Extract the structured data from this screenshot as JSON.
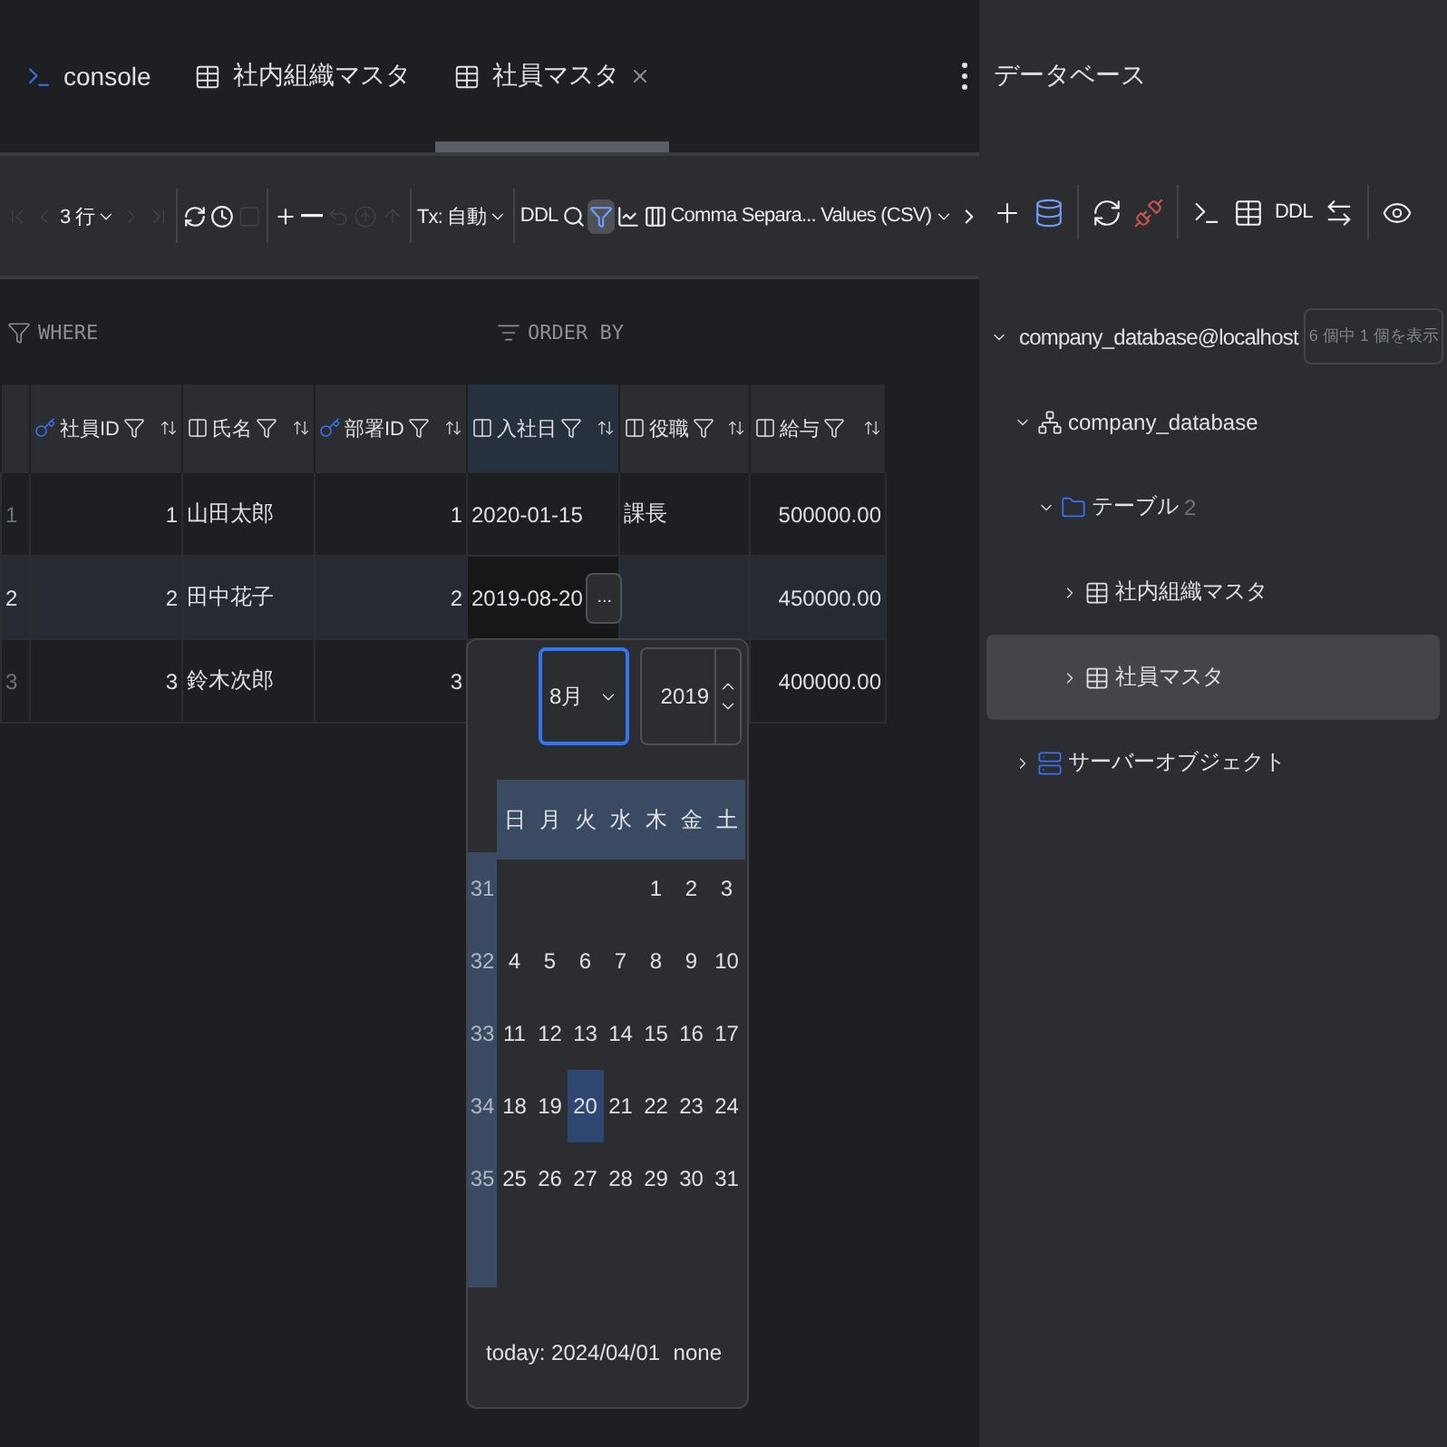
{
  "tabs": [
    {
      "label": "console",
      "kind": "console",
      "selected": false,
      "closable": false
    },
    {
      "label": "社内組織マスタ",
      "kind": "table",
      "selected": false,
      "closable": false
    },
    {
      "label": "社員マスタ",
      "kind": "table",
      "selected": true,
      "closable": true
    }
  ],
  "toolbar": [
    {
      "kind": "first",
      "disabled": true
    },
    {
      "kind": "prev",
      "disabled": true
    },
    {
      "kind": "dropdown",
      "label": "3 行",
      "disabled": false
    },
    {
      "kind": "next",
      "disabled": true
    },
    {
      "kind": "last",
      "disabled": true
    },
    {
      "kind": "sep"
    },
    {
      "kind": "refresh",
      "disabled": false
    },
    {
      "kind": "history",
      "disabled": false
    },
    {
      "kind": "stop",
      "disabled": true
    },
    {
      "kind": "sep"
    },
    {
      "kind": "add",
      "disabled": false
    },
    {
      "kind": "remove",
      "disabled": false
    },
    {
      "kind": "revert",
      "disabled": true
    },
    {
      "kind": "submit",
      "disabled": true
    },
    {
      "kind": "upload",
      "disabled": true
    },
    {
      "kind": "sep"
    },
    {
      "kind": "dropdown",
      "label": "Tx: 自動",
      "disabled": false
    },
    {
      "kind": "sep"
    },
    {
      "kind": "text",
      "label": "DDL",
      "disabled": false
    },
    {
      "kind": "search",
      "disabled": false
    },
    {
      "kind": "view",
      "disabled": false,
      "active": true
    },
    {
      "kind": "chart",
      "disabled": false
    },
    {
      "kind": "columns",
      "disabled": false
    },
    {
      "kind": "dropdown",
      "label": "Comma Separa... Values (CSV)",
      "disabled": false
    },
    {
      "kind": "more",
      "disabled": false
    }
  ],
  "filters": {
    "where": "WHERE",
    "order_by": "ORDER BY"
  },
  "table": {
    "columns": [
      {
        "name": "社員ID",
        "kind": "key",
        "selected": false
      },
      {
        "name": "氏名",
        "kind": "column",
        "selected": false
      },
      {
        "name": "部署ID",
        "kind": "key",
        "selected": false
      },
      {
        "name": "入社日",
        "kind": "column",
        "selected": true
      },
      {
        "name": "役職",
        "kind": "column",
        "selected": false
      },
      {
        "name": "給与",
        "kind": "column",
        "selected": false
      }
    ],
    "rows": [
      {
        "number": "1",
        "selected": false,
        "cells": [
          {
            "value": "1",
            "editing": false
          },
          {
            "value": "山田太郎",
            "editing": false
          },
          {
            "value": "1",
            "editing": false
          },
          {
            "value": "2020-01-15",
            "editing": false
          },
          {
            "value": "課長",
            "editing": false
          },
          {
            "value": "500000.00",
            "editing": false
          }
        ]
      },
      {
        "number": "2",
        "selected": true,
        "cells": [
          {
            "value": "2",
            "editing": false
          },
          {
            "value": "田中花子",
            "editing": false
          },
          {
            "value": "2",
            "editing": false
          },
          {
            "value": "2019-08-20",
            "editing": true,
            "edit_button": "..."
          },
          {
            "editing": false
          },
          {
            "value": "450000.00",
            "editing": false
          }
        ]
      },
      {
        "number": "3",
        "selected": false,
        "cells": [
          {
            "value": "3",
            "editing": false
          },
          {
            "value": "鈴木次郎",
            "editing": false
          },
          {
            "value": "3",
            "editing": false
          },
          {},
          {},
          {
            "value": "400000.00",
            "editing": false
          }
        ]
      }
    ]
  },
  "date_picker": {
    "month": "8月",
    "year": "2019",
    "weekdays": [
      "日",
      "月",
      "火",
      "水",
      "木",
      "金",
      "土"
    ],
    "weeks": [
      {
        "number": "31",
        "days": [
          {
            "label": "1",
            "selected": false
          },
          {
            "label": "2",
            "selected": false
          },
          {
            "label": "3",
            "selected": false
          }
        ]
      },
      {
        "number": "32",
        "days": [
          {
            "label": "4",
            "selected": false
          },
          {
            "label": "5",
            "selected": false
          },
          {
            "label": "6",
            "selected": false
          },
          {
            "label": "7",
            "selected": false
          },
          {
            "label": "8",
            "selected": false
          },
          {
            "label": "9",
            "selected": false
          },
          {
            "label": "10",
            "selected": false
          }
        ]
      },
      {
        "number": "33",
        "days": [
          {
            "label": "11",
            "selected": false
          },
          {
            "label": "12",
            "selected": false
          },
          {
            "label": "13",
            "selected": false
          },
          {
            "label": "14",
            "selected": false
          },
          {
            "label": "15",
            "selected": false
          },
          {
            "label": "16",
            "selected": false
          },
          {
            "label": "17",
            "selected": false
          }
        ]
      },
      {
        "number": "34",
        "days": [
          {
            "label": "18",
            "selected": false
          },
          {
            "label": "19",
            "selected": false
          },
          {
            "label": "20",
            "selected": true
          },
          {
            "label": "21",
            "selected": false
          },
          {
            "label": "22",
            "selected": false
          },
          {
            "label": "23",
            "selected": false
          },
          {
            "label": "24",
            "selected": false
          }
        ]
      },
      {
        "number": "35",
        "days": [
          {
            "label": "25",
            "selected": false
          },
          {
            "label": "26",
            "selected": false
          },
          {
            "label": "27",
            "selected": false
          },
          {
            "label": "28",
            "selected": false
          },
          {
            "label": "29",
            "selected": false
          },
          {
            "label": "30",
            "selected": false
          },
          {
            "label": "31",
            "selected": false
          }
        ]
      }
    ],
    "today": "today: 2024/04/01",
    "none": "none"
  },
  "database_panel": {
    "title": "データベース",
    "toolbar": [
      {
        "kind": "add"
      },
      {
        "kind": "datasource"
      },
      {
        "kind": "sep"
      },
      {
        "kind": "refresh"
      },
      {
        "kind": "disconnect"
      },
      {
        "kind": "sep"
      },
      {
        "kind": "console"
      },
      {
        "kind": "table"
      },
      {
        "kind": "ddl",
        "label": "DDL"
      },
      {
        "kind": "jump"
      },
      {
        "kind": "sep"
      },
      {
        "kind": "view"
      }
    ],
    "tree": [
      {
        "label": "company_database@localhost",
        "kind": "connection",
        "expanded": true,
        "selected": false,
        "badge": "6 個中 1 個を表示",
        "children": [
          {
            "label": "company_database",
            "kind": "schema",
            "expanded": true,
            "selected": false,
            "children": [
              {
                "label": "テーブル",
                "kind": "folder",
                "expanded": true,
                "selected": false,
                "count": "2",
                "children": [
                  {
                    "label": "社内組織マスタ",
                    "kind": "table",
                    "expanded": false,
                    "selected": false
                  },
                  {
                    "label": "社員マスタ",
                    "kind": "table",
                    "expanded": false,
                    "selected": true
                  }
                ]
              }
            ]
          },
          {
            "label": "サーバーオブジェクト",
            "kind": "server",
            "expanded": false,
            "selected": false
          }
        ]
      }
    ]
  }
}
